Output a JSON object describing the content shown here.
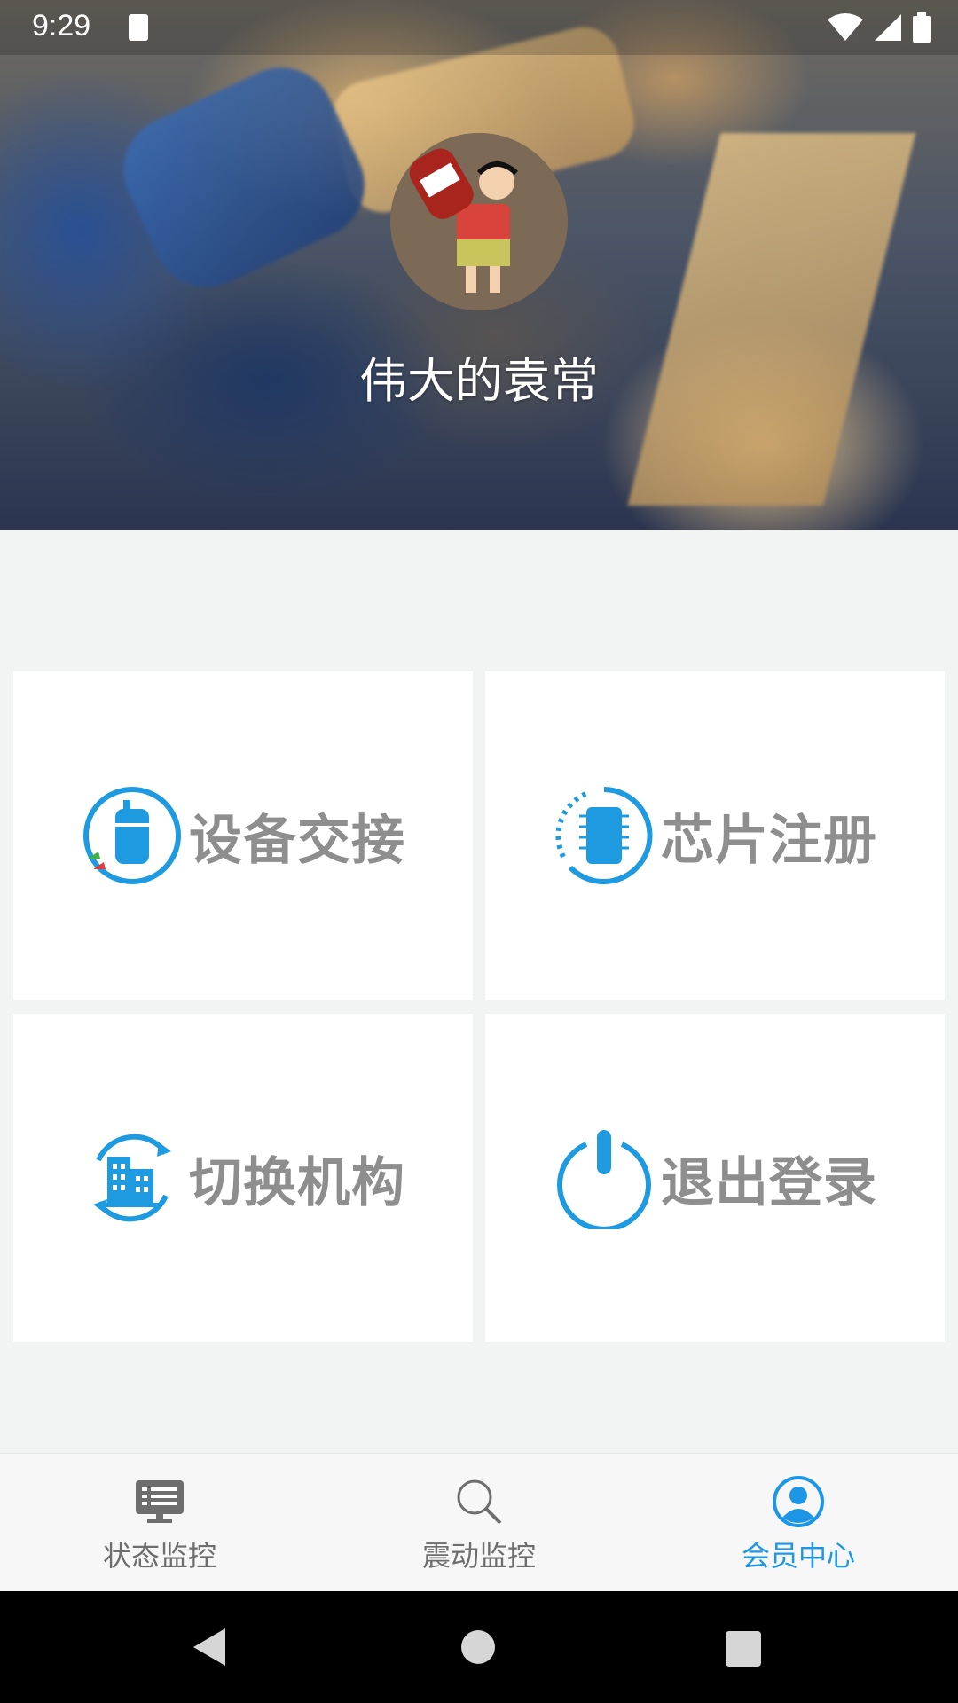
{
  "status_bar": {
    "time": "9:29",
    "icons": [
      "sd-card-icon",
      "wifi-icon",
      "signal-icon",
      "battery-icon"
    ]
  },
  "profile": {
    "username": "伟大的袁常",
    "avatar": "avatar-image"
  },
  "menu": [
    {
      "label": "设备交接",
      "icon": "device-handover-icon"
    },
    {
      "label": "芯片注册",
      "icon": "chip-register-icon"
    },
    {
      "label": "切换机构",
      "icon": "switch-organization-icon"
    },
    {
      "label": "退出登录",
      "icon": "power-icon"
    }
  ],
  "bottom_nav": {
    "items": [
      {
        "label": "状态监控",
        "icon": "monitor-icon",
        "active": false
      },
      {
        "label": "震动监控",
        "icon": "search-icon",
        "active": false
      },
      {
        "label": "会员中心",
        "icon": "user-icon",
        "active": true
      }
    ]
  },
  "system_nav": {
    "buttons": [
      "back-icon",
      "home-icon",
      "recents-icon"
    ]
  },
  "colors": {
    "accent": "#1e96e6",
    "tile_text": "#8e8e8e",
    "background": "#f2f3f3",
    "system_nav": "#000000"
  }
}
